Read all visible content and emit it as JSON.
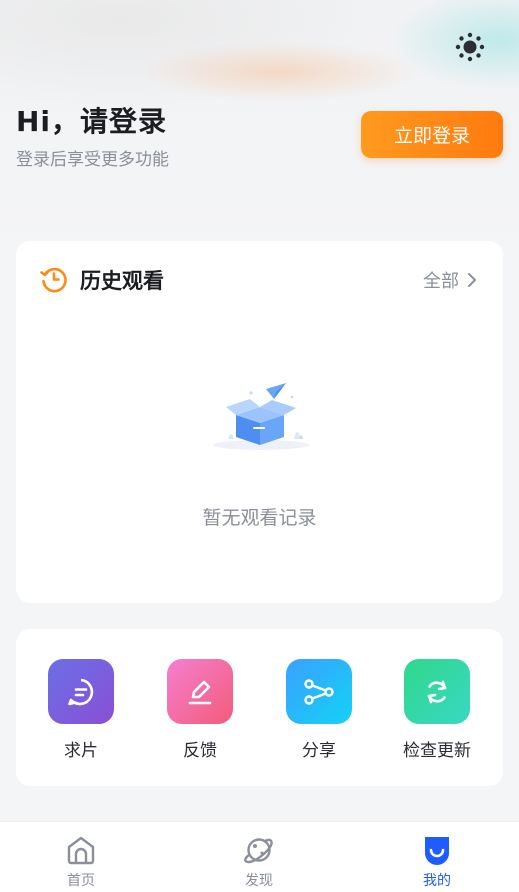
{
  "header": {
    "greeting": "Hi，请登录",
    "subtitle": "登录后享受更多功能",
    "login_button": "立即登录",
    "theme_icon": "sun-icon"
  },
  "history": {
    "title": "历史观看",
    "all_link": "全部",
    "empty_text": "暂无观看记录",
    "icon": "history-clock-icon"
  },
  "tools": [
    {
      "label": "求片",
      "icon": "request-chat-icon"
    },
    {
      "label": "反馈",
      "icon": "feedback-pen-icon"
    },
    {
      "label": "分享",
      "icon": "share-icon"
    },
    {
      "label": "检查更新",
      "icon": "refresh-icon"
    }
  ],
  "nav": {
    "items": [
      {
        "label": "首页",
        "icon": "home-icon"
      },
      {
        "label": "发现",
        "icon": "planet-icon"
      },
      {
        "label": "我的",
        "icon": "profile-icon"
      }
    ],
    "active": "我的"
  },
  "colors": {
    "accent_orange": "#ff8a16",
    "active_blue": "#1f5cff",
    "tool_request": "#7a5ce0",
    "tool_feedback": "#f2609a",
    "tool_share": "#1fb6ff",
    "tool_update": "#22d49a"
  }
}
